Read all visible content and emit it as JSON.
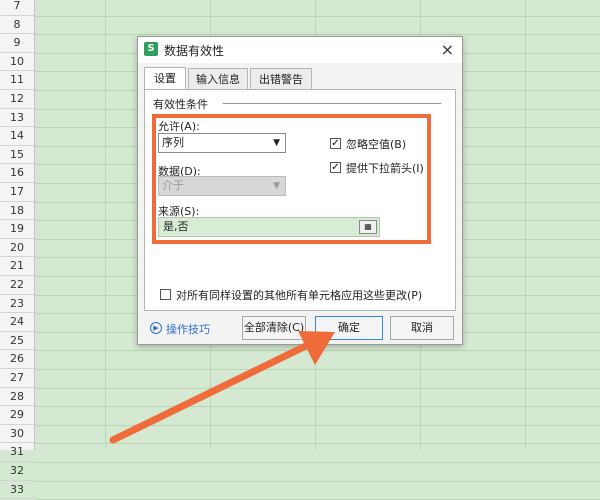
{
  "row_numbers": [
    "7",
    "8",
    "9",
    "10",
    "11",
    "12",
    "13",
    "14",
    "15",
    "16",
    "17",
    "18",
    "19",
    "20",
    "21",
    "22",
    "23",
    "24",
    "25",
    "26",
    "27",
    "28",
    "29",
    "30",
    "31",
    "32",
    "33"
  ],
  "dialog": {
    "title": "数据有效性",
    "app_icon": "S",
    "close_icon": "×",
    "tabs": [
      "设置",
      "输入信息",
      "出错警告"
    ],
    "section_title": "有效性条件",
    "allow_label": "允许(A):",
    "allow_value": "序列",
    "data_label": "数据(D):",
    "data_value": "介于",
    "ignore_blank_label": "忽略空值(B)",
    "ignore_blank_checked": true,
    "dropdown_label": "提供下拉箭头(I)",
    "dropdown_checked": true,
    "source_label": "来源(S):",
    "source_value": "是,否",
    "apply_all_label": "对所有同样设置的其他所有单元格应用这些更改(P)",
    "apply_all_checked": false,
    "tips_label": "操作技巧",
    "clear_all_label": "全部清除(C)",
    "ok_label": "确定",
    "cancel_label": "取消"
  },
  "colors": {
    "highlight": "#ef6b3a",
    "grid_bg": "#d5e9d2",
    "source_bg": "#d8ecd4",
    "link": "#2d6fd1"
  },
  "icons": {
    "combo_arrow": "chevron-down-icon",
    "checkbox_mark": "checkmark-icon",
    "tips": "play-circle-icon",
    "ref": "range-select-icon"
  }
}
